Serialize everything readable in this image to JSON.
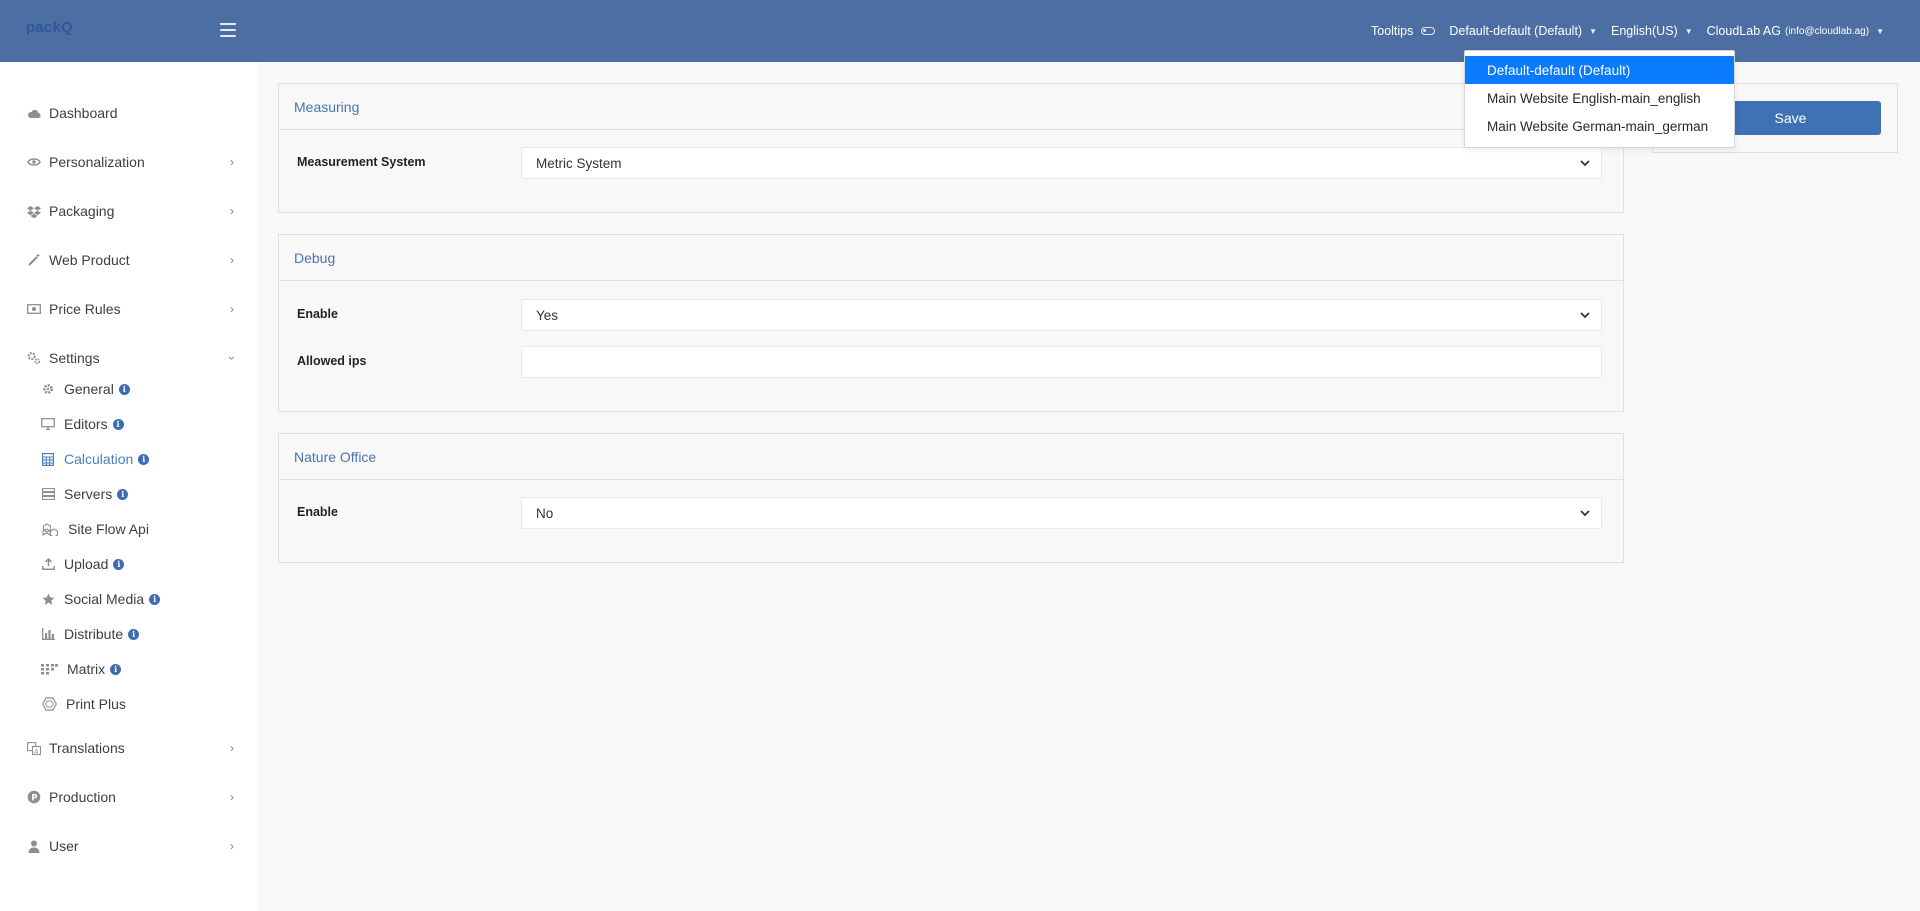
{
  "header": {
    "brand": "packQ",
    "tooltips_label": "Tooltips",
    "store_label": "Default-default (Default)",
    "language_label": "English(US)",
    "user_label": "CloudLab AG",
    "user_email": "(info@cloudlab.ag)"
  },
  "store_dropdown": {
    "options": [
      "Default-default (Default)",
      "Main Website English-main_english",
      "Main Website German-main_german"
    ],
    "selected_index": 0
  },
  "sidebar": {
    "items": [
      {
        "label": "Dashboard",
        "icon": "cloud-icon"
      },
      {
        "label": "Personalization",
        "icon": "eye-icon"
      },
      {
        "label": "Packaging",
        "icon": "dropbox-icon"
      },
      {
        "label": "Web Product",
        "icon": "magic-wand-icon"
      },
      {
        "label": "Price Rules",
        "icon": "money-icon"
      },
      {
        "label": "Settings",
        "icon": "cogs-icon"
      },
      {
        "label": "Translations",
        "icon": "translate-icon"
      },
      {
        "label": "Production",
        "icon": "production-icon"
      },
      {
        "label": "User",
        "icon": "user-icon"
      }
    ],
    "settings_sub": [
      {
        "label": "General",
        "icon": "gear-icon"
      },
      {
        "label": "Editors",
        "icon": "desktop-icon"
      },
      {
        "label": "Calculation",
        "icon": "calculator-icon"
      },
      {
        "label": "Servers",
        "icon": "server-icon"
      },
      {
        "label": "Site Flow Api",
        "icon": "cubes-icon"
      },
      {
        "label": "Upload",
        "icon": "upload-icon"
      },
      {
        "label": "Social Media",
        "icon": "star-icon"
      },
      {
        "label": "Distribute",
        "icon": "bar-chart-icon"
      },
      {
        "label": "Matrix",
        "icon": "matrix-icon"
      },
      {
        "label": "Print Plus",
        "icon": "hexagon-icon"
      }
    ],
    "active_sub": "Calculation"
  },
  "main": {
    "measuring": {
      "title": "Measuring",
      "measurement_system_label": "Measurement System",
      "measurement_system_value": "Metric System"
    },
    "debug": {
      "title": "Debug",
      "enable_label": "Enable",
      "enable_value": "Yes",
      "allowed_ips_label": "Allowed ips",
      "allowed_ips_value": ""
    },
    "nature_office": {
      "title": "Nature Office",
      "enable_label": "Enable",
      "enable_value": "No"
    },
    "save_label": "Save"
  },
  "colors": {
    "header_bg": "#4d6ea3",
    "accent": "#3f72b5",
    "dropdown_selected": "#0a7bff",
    "active_nav": "#4a7fc1"
  }
}
